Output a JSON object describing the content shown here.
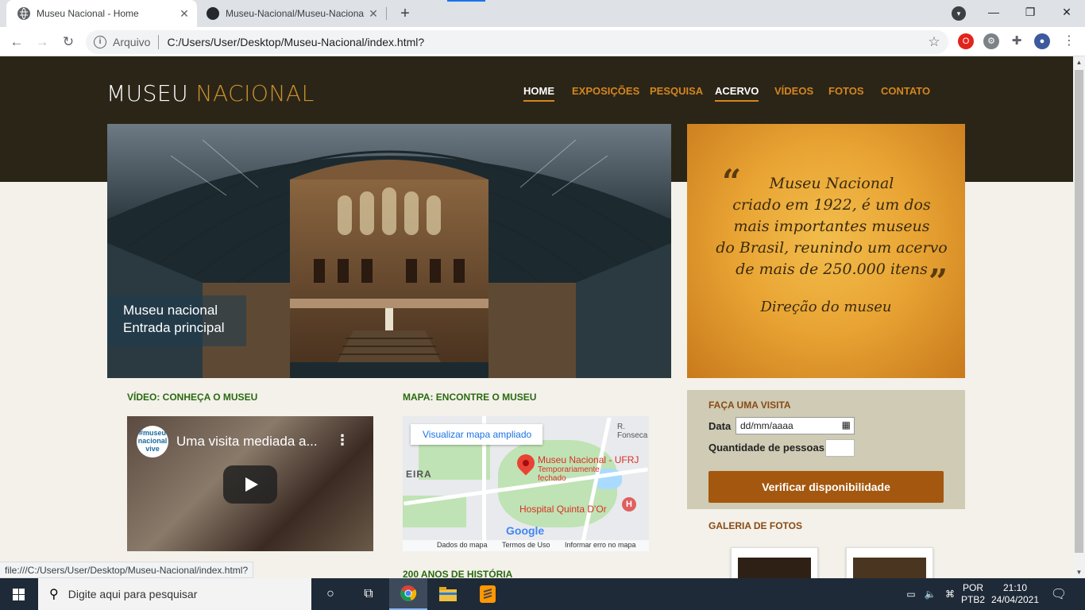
{
  "browser": {
    "tabs": [
      {
        "title": "Museu Nacional - Home",
        "active": true
      },
      {
        "title": "Museu-Nacional/Museu-Naciona",
        "active": false
      }
    ],
    "new_tab": "+",
    "address": {
      "scheme_label": "Arquivo",
      "url": "C:/Users/User/Desktop/Museu-Nacional/index.html?"
    },
    "status_url": "file:///C:/Users/User/Desktop/Museu-Nacional/index.html?"
  },
  "site": {
    "logo": {
      "part1": "MUSEU ",
      "part2": "NACIONAL"
    },
    "nav": [
      "HOME",
      "EXPOSIÇÕES",
      "PESQUISA",
      "ACERVO",
      "VÍDEOS",
      "FOTOS",
      "CONTATO"
    ],
    "hero_caption": {
      "line1": "Museu nacional",
      "line2": "Entrada principal"
    },
    "quote": {
      "line1": "Museu Nacional",
      "line2": "criado em 1922, é um dos",
      "line3": "mais importantes museus",
      "line4": "do Brasil, reunindo um acervo",
      "line5": "de mais de 250.000 itens",
      "signature": "Direção do museu"
    },
    "visit": {
      "title": "FAÇA UMA VISITA",
      "date_label": "Data",
      "date_placeholder": "dd/mm/aaaa",
      "qty_label": "Quantidade de pessoas",
      "button": "Verificar disponibilidade"
    },
    "gallery_title": "GALERIA DE FOTOS",
    "video_section": {
      "title": "VÍDEO: CONHEÇA O MUSEU",
      "video_title": "Uma visita mediada a...",
      "channel": "#museu nacional vive"
    },
    "map_section": {
      "title": "MAPA: ENCONTRE O MUSEU",
      "open_larger": "Visualizar mapa ampliado",
      "place": "Museu Nacional - UFRJ",
      "place_sub1": "Temporariamente",
      "place_sub2": "fechado",
      "hospital": "Hospital Quinta D'Or",
      "footer": [
        "Dados do mapa",
        "Termos de Uso",
        "Informar erro no mapa"
      ],
      "street": "R. Fonseca",
      "area_label": "EIRA",
      "google": "Google"
    },
    "history_title": "200 ANOS DE HISTÓRIA"
  },
  "taskbar": {
    "search_placeholder": "Digite aqui para pesquisar",
    "lang1": "POR",
    "lang2": "PTB2",
    "time": "21:10",
    "date": "24/04/2021"
  }
}
